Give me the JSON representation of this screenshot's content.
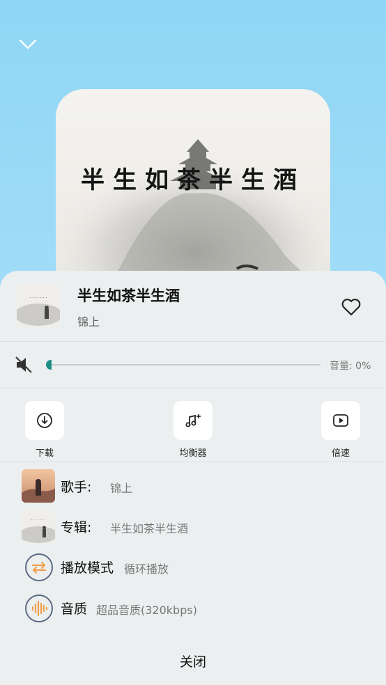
{
  "song": {
    "title": "半生如茶半生酒",
    "artist": "锦上",
    "cover_text": "半生如茶半生酒"
  },
  "volume": {
    "label": "音量: 0%",
    "level": 0
  },
  "actions": [
    {
      "label": "下载",
      "icon": "download-icon"
    },
    {
      "label": "均衡器",
      "icon": "equalizer-icon"
    },
    {
      "label": "倍速",
      "icon": "playback-speed-icon"
    }
  ],
  "info": {
    "singer_key": "歌手:",
    "singer_value": "锦上",
    "album_key": "专辑:",
    "album_value": "半生如茶半生酒",
    "mode_key": "播放模式",
    "mode_value": "循环播放",
    "quality_key": "音质",
    "quality_value": "超品音质(320kbps)"
  },
  "close_label": "关闭",
  "colors": {
    "accent": "#1e8f86",
    "mode_icon": "#f0a04b",
    "quality_icon": "#f0a04b",
    "icon_ring": "#5a6a86"
  }
}
